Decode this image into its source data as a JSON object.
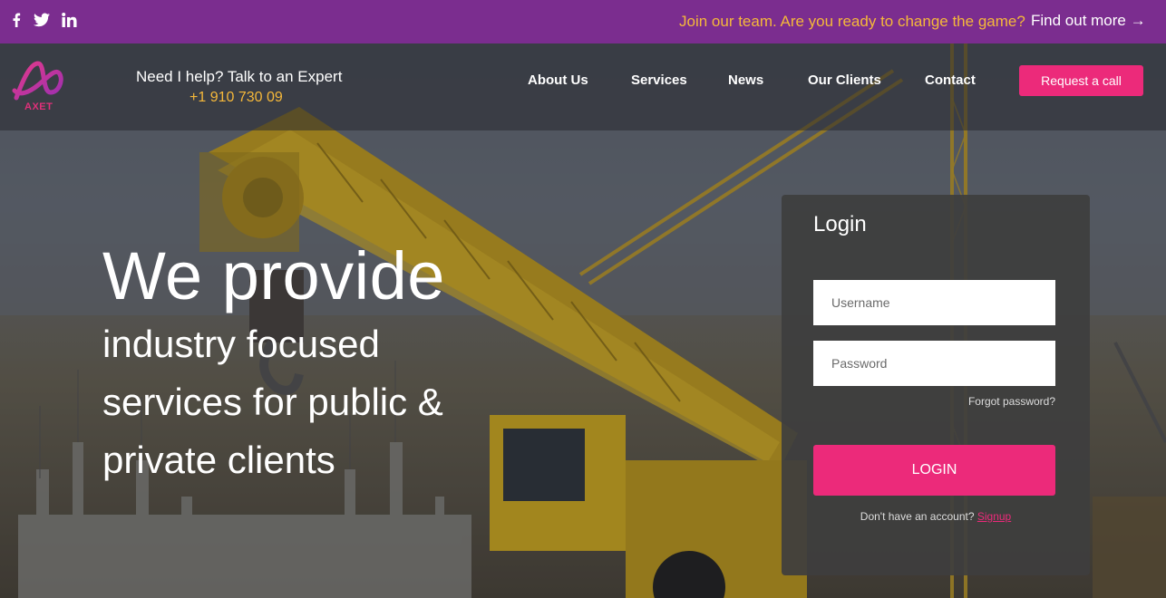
{
  "topbar": {
    "social": [
      {
        "name": "facebook-icon",
        "glyph": "f"
      },
      {
        "name": "twitter-icon",
        "glyph": "t"
      },
      {
        "name": "linkedin-icon",
        "glyph": "in"
      }
    ],
    "promo": "Join our team. Are you ready to change the game?",
    "find_out": "Find out more →"
  },
  "header": {
    "logo_text": "AXET",
    "help_text": "Need I help? Talk to an Expert",
    "phone": "+1 910 730 09",
    "nav": {
      "about": "About Us",
      "services": "Services",
      "news": "News",
      "clients": "Our Clients",
      "contact": "Contact"
    },
    "request_button": "Request a call"
  },
  "hero": {
    "headline": "We provide",
    "line1": "industry focused",
    "line2": "services for public &",
    "line3": "private clients"
  },
  "login": {
    "title": "Login",
    "username_placeholder": "Username",
    "password_placeholder": "Password",
    "forgot": "Forgot password?",
    "button": "LOGIN",
    "no_account": "Don't have an account?",
    "signup": "Signup"
  },
  "colors": {
    "topbar": "#7b2d8f",
    "accent": "#ec2a7a",
    "gold": "#f5b83a"
  }
}
